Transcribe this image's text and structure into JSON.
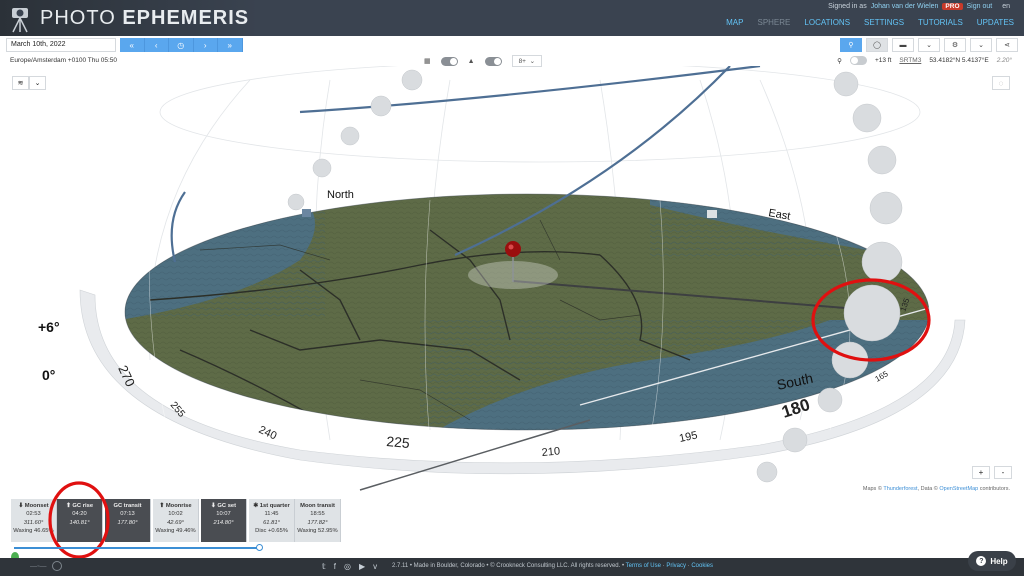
{
  "app": {
    "brand_light": "PHOTO",
    "brand_bold": "EPHEMERIS",
    "signin_prefix": "Signed in as",
    "user": "Johan van der Wielen",
    "badge": "PRO",
    "signout": "Sign out",
    "lang": "en"
  },
  "nav": [
    "MAP",
    "SPHERE",
    "LOCATIONS",
    "SETTINGS",
    "TUTORIALS",
    "UPDATES"
  ],
  "toolbar": {
    "date": "March 10th, 2022",
    "nav_icons": [
      "double-chevron-left-icon",
      "chevron-left-icon",
      "clock-icon",
      "chevron-right-icon",
      "double-chevron-right-icon"
    ],
    "nav_glyphs": [
      "«",
      "‹",
      "◷",
      "›",
      "»"
    ]
  },
  "info": {
    "timezone": "Europe/Amsterdam +0100 Thu 05:50",
    "zoom_select": "8+",
    "elevation": "+13 ft",
    "srtm": "SRTM3",
    "coords": "53.4182°N 5.4137°E",
    "tilt": "2.20°"
  },
  "sphere": {
    "labels": {
      "north": "North",
      "east": "East",
      "south": "South",
      "elev_plus6": "+6°",
      "elev_zero": "0°"
    },
    "bearings": [
      "270",
      "255",
      "240",
      "225",
      "210",
      "195",
      "180",
      "165",
      "135"
    ]
  },
  "map_attribution": {
    "prefix": "Maps ©",
    "thunderforest": "Thunderforest",
    "data": ", Data ©",
    "osm": "OpenStreetMap",
    "suffix": "contributors."
  },
  "zoom": {
    "plus": "+",
    "minus": "-"
  },
  "events": [
    {
      "title": "⬇ Moonset",
      "time": "02:53",
      "value": "311.60°",
      "note": "Waxing 46.65%",
      "style": "light"
    },
    {
      "title": "⬆ GC rise",
      "time": "04:20",
      "value": "140.81°",
      "note": "",
      "style": "dark"
    },
    {
      "title": "GC transit",
      "time": "07:13",
      "value": "177.80°",
      "note": "",
      "style": "dark"
    },
    {
      "title": "⬆ Moonrise",
      "time": "10:02",
      "value": "42.69°",
      "note": "Waxing 49.46%",
      "style": "light"
    },
    {
      "title": "⬇ GC set",
      "time": "10:07",
      "value": "214.80°",
      "note": "",
      "style": "dark"
    },
    {
      "title": "✱ 1st quarter",
      "time": "11:45",
      "value": "61.81°",
      "note": "Disc +0.65%",
      "style": "light"
    },
    {
      "title": "Moon transit",
      "time": "18:55",
      "value": "177.82°",
      "note": "Waxing 52.95%",
      "style": "light"
    }
  ],
  "timeline": {
    "progress": 0.24
  },
  "footer": {
    "social_icons": [
      "twitter-icon",
      "facebook-icon",
      "instagram-icon",
      "youtube-icon",
      "vimeo-icon"
    ],
    "social_glyphs": [
      "𝕥",
      "f",
      "◎",
      "▶",
      "v"
    ],
    "version_text": "2.7.11 • Made in Boulder, Colorado • © Crookneck Consulting LLC. All rights reserved. •",
    "terms": "Terms of Use",
    "privacy": "Privacy",
    "cookies": "Cookies",
    "help": "Help"
  },
  "colors": {
    "accent": "#5aa7ee",
    "header": "#3a4350",
    "annotation": "#e01010",
    "land": "#5e6b47",
    "water": "#4d6f80"
  }
}
